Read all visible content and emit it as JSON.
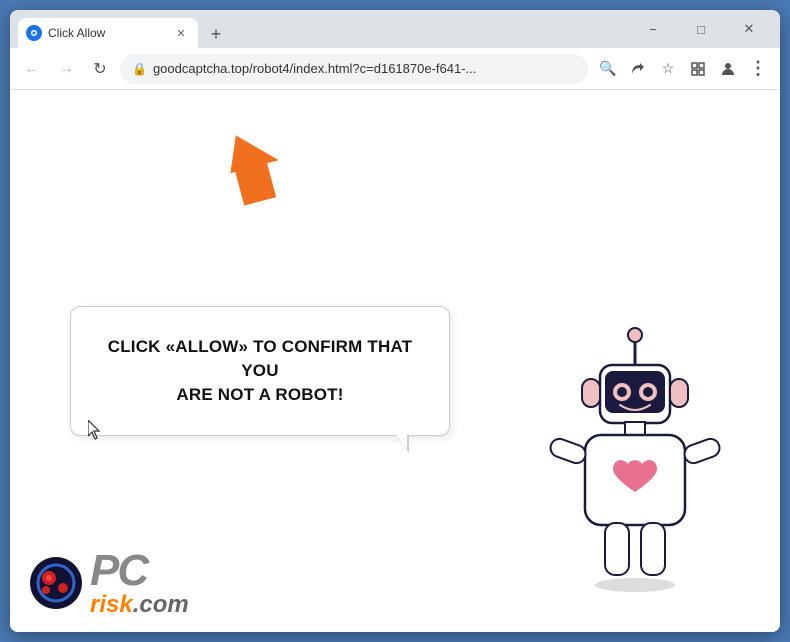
{
  "browser": {
    "tab": {
      "title": "Click Allow",
      "favicon_label": "G"
    },
    "new_tab_label": "+",
    "window_controls": {
      "minimize": "−",
      "maximize": "□",
      "close": "✕"
    },
    "nav": {
      "back": "←",
      "forward": "→",
      "refresh": "↻"
    },
    "url": "goodcaptcha.top/robot4/index.html?c=d161870e-f641-...",
    "url_icons": {
      "lock": "🔒",
      "search": "🔍",
      "share": "↗",
      "bookmark": "☆",
      "extensions": "□",
      "profile": "👤",
      "menu_dots": "⋮"
    }
  },
  "page": {
    "bubble_line1": "CLICK «ALLOW» TO CONFIRM THAT YOU",
    "bubble_line2": "ARE NOT A ROBOT!",
    "arrow_color": "#f07020"
  },
  "logo": {
    "pc": "PC",
    "risk": "risk",
    "com": ".com"
  }
}
